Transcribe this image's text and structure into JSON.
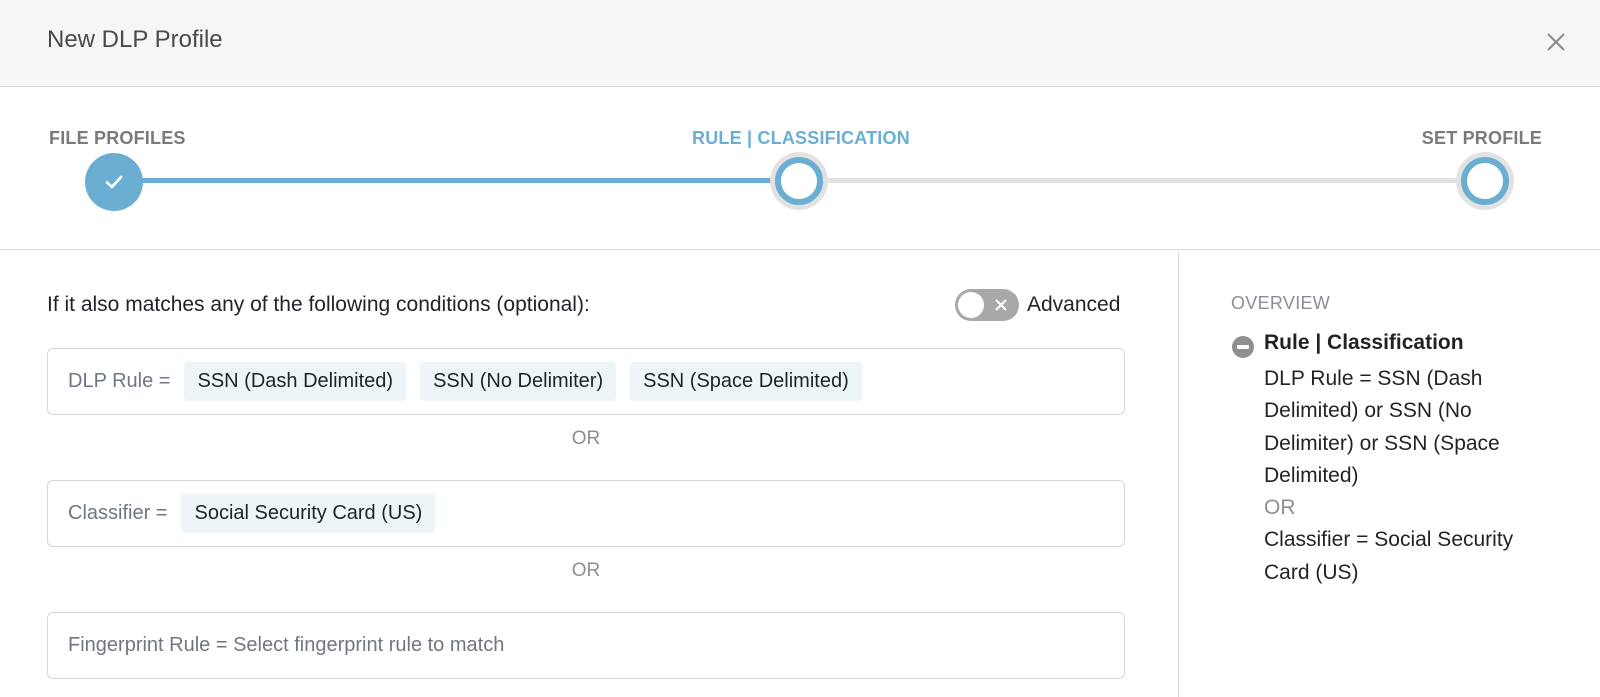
{
  "header": {
    "title": "New DLP Profile",
    "close_icon": "close-icon"
  },
  "stepper": {
    "steps": [
      {
        "label": "FILE PROFILES",
        "state": "completed"
      },
      {
        "label": "RULE | CLASSIFICATION",
        "state": "current"
      },
      {
        "label": "SET PROFILE",
        "state": "upcoming"
      }
    ],
    "accent": "#6aaed2"
  },
  "conditions": {
    "label": "If it also matches any of the following conditions (optional):",
    "advanced": {
      "label": "Advanced",
      "enabled": false
    },
    "dlp_rule": {
      "key": "DLP Rule =",
      "chips": [
        "SSN (Dash Delimited)",
        "SSN (No Delimiter)",
        "SSN (Space Delimited)"
      ]
    },
    "or_1": "OR",
    "classifier": {
      "key": "Classifier =",
      "chips": [
        "Social Security Card (US)"
      ]
    },
    "or_2": "OR",
    "fingerprint": {
      "placeholder": "Fingerprint Rule = Select fingerprint rule to match"
    }
  },
  "overview": {
    "title": "OVERVIEW",
    "section_heading": "Rule | Classification",
    "dlp_rule_text": "DLP Rule = SSN (Dash Delimited) or SSN (No Delimiter) or SSN (Space Delimited)",
    "or": "OR",
    "classifier_text": "Classifier = Social Security Card (US)"
  }
}
